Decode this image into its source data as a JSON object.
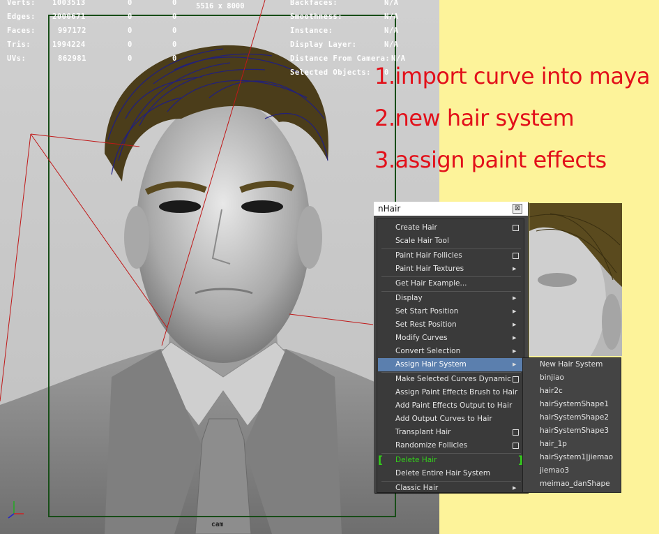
{
  "hud": {
    "stats": [
      {
        "label": "Verts:",
        "v1": "1003513",
        "v2": "0",
        "v3": "0"
      },
      {
        "label": "Edges:",
        "v1": "2000671",
        "v2": "0",
        "v3": "0"
      },
      {
        "label": "Faces:",
        "v1": "997172",
        "v2": "0",
        "v3": "0"
      },
      {
        "label": "Tris:",
        "v1": "1994224",
        "v2": "0",
        "v3": "0"
      },
      {
        "label": "UVs:",
        "v1": "862981",
        "v2": "0",
        "v3": "0"
      }
    ],
    "props": [
      {
        "label": "Backfaces:",
        "value": "N/A"
      },
      {
        "label": "Smoothness:",
        "value": "N/A"
      },
      {
        "label": "Instance:",
        "value": "N/A"
      },
      {
        "label": "Display Layer:",
        "value": "N/A"
      },
      {
        "label": "Distance From Camera:",
        "value": "N/A"
      },
      {
        "label": "Selected Objects:",
        "value": "0"
      }
    ],
    "resolution": "5516 x 8000",
    "camera": "cam"
  },
  "steps": [
    "1.import curve into maya",
    "2.new hair system",
    "3.assign paint effects"
  ],
  "nhair": {
    "title": "nHair",
    "close": "⊠",
    "items": [
      {
        "label": "Create Hair",
        "suffix": "box"
      },
      {
        "label": "Scale Hair Tool",
        "suffix": ""
      },
      {
        "label": "Paint Hair Follicles",
        "suffix": "box"
      },
      {
        "label": "Paint Hair Textures",
        "suffix": "arrow"
      },
      {
        "label": "Get Hair Example...",
        "suffix": ""
      },
      {
        "label": "Display",
        "suffix": "arrow"
      },
      {
        "label": "Set Start Position",
        "suffix": "arrow"
      },
      {
        "label": "Set Rest Position",
        "suffix": "arrow"
      },
      {
        "label": "Modify Curves",
        "suffix": "arrow"
      },
      {
        "label": "Convert Selection",
        "suffix": "arrow"
      },
      {
        "label": "Assign Hair System",
        "suffix": "arrow"
      },
      {
        "label": "Make Selected Curves Dynamic",
        "suffix": "box"
      },
      {
        "label": "Assign Paint Effects Brush to Hair",
        "suffix": ""
      },
      {
        "label": "Add Paint Effects Output to Hair",
        "suffix": ""
      },
      {
        "label": "Add Output Curves to Hair",
        "suffix": ""
      },
      {
        "label": "Transplant Hair",
        "suffix": "box"
      },
      {
        "label": "Randomize Follicles",
        "suffix": "box"
      },
      {
        "label": "Delete Hair",
        "suffix": "bracket"
      },
      {
        "label": "Delete Entire Hair System",
        "suffix": ""
      },
      {
        "label": "Classic Hair",
        "suffix": "arrow"
      }
    ],
    "highlighted": "Assign Hair System",
    "accent_highlight": "#5b7fae",
    "accent_green": "#33d11a"
  },
  "submenu": {
    "items": [
      "New Hair System",
      "binjiao",
      "hair2c",
      "hairSystemShape1",
      "hairSystemShape2",
      "hairSystemShape3",
      "hair_1p",
      "hairSystem1|jiemao",
      "jiemao3",
      "meimao_danShape"
    ]
  },
  "colors": {
    "step_text": "#e2101a",
    "background_yellow": "#fdf39a"
  }
}
